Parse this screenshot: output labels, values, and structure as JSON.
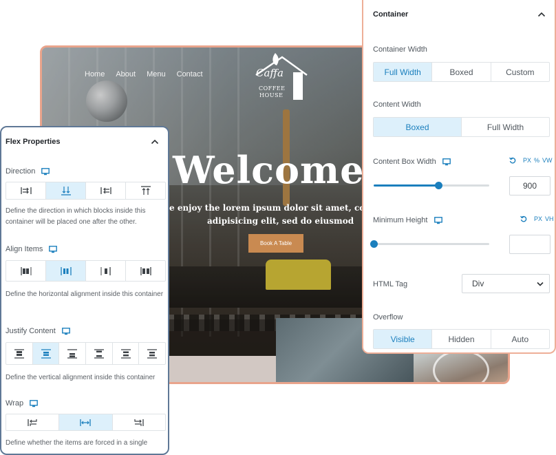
{
  "preview": {
    "nav": [
      "Home",
      "About",
      "Menu",
      "Contact"
    ],
    "logo": {
      "script": "Caffa",
      "line1": "COFFEE",
      "line2": "HOUSE"
    },
    "hero_title": "Welcome",
    "hero_line1": "e enjoy the lorem ipsum dolor sit amet, cons",
    "hero_line2": "adipisicing elit, sed do eiusmod",
    "book_button": "Book A Table"
  },
  "flex_panel": {
    "title": "Flex Properties",
    "direction": {
      "label": "Direction",
      "desc": "Define the direction in which blocks inside this container will be placed one after the other.",
      "options": [
        "row-icon",
        "column-icon",
        "row-reverse-icon",
        "column-reverse-icon"
      ],
      "active": 1
    },
    "align_items": {
      "label": "Align Items",
      "desc": "Define the horizontal alignment inside this container",
      "options": [
        "align-start-icon",
        "align-center-icon",
        "align-end-icon",
        "align-stretch-icon"
      ],
      "active": 1
    },
    "justify_content": {
      "label": "Justify Content",
      "desc": "Define the vertical alignment inside this container",
      "options": [
        "justify-start-icon",
        "justify-center-icon",
        "justify-end-icon",
        "justify-space-between-icon",
        "justify-space-around-icon",
        "justify-space-evenly-icon"
      ],
      "active": 1
    },
    "wrap": {
      "label": "Wrap",
      "desc": "Define whether the items are forced in a single",
      "options": [
        "nowrap-icon",
        "wrap-icon",
        "wrap-reverse-icon"
      ],
      "active": 1
    }
  },
  "container_panel": {
    "title": "Container",
    "container_width": {
      "label": "Container Width",
      "options": [
        "Full Width",
        "Boxed",
        "Custom"
      ],
      "active": 0
    },
    "content_width": {
      "label": "Content Width",
      "options": [
        "Boxed",
        "Full Width"
      ],
      "active": 0
    },
    "content_box_width": {
      "label": "Content Box Width",
      "units": [
        "PX",
        "%",
        "VW"
      ],
      "value": "900",
      "slider_fraction": 0.56
    },
    "minimum_height": {
      "label": "Minimum Height",
      "units": [
        "PX",
        "VH"
      ],
      "value": "",
      "slider_fraction": 0.0
    },
    "html_tag": {
      "label": "HTML Tag",
      "value": "Div"
    },
    "overflow": {
      "label": "Overflow",
      "options": [
        "Visible",
        "Hidden",
        "Auto"
      ],
      "active": 0
    }
  },
  "colors": {
    "accent": "#1b7fbd",
    "active_bg": "#ddf0fb",
    "flex_border": "#5f7896",
    "container_border": "#eeae97",
    "button": "#c98a51"
  }
}
